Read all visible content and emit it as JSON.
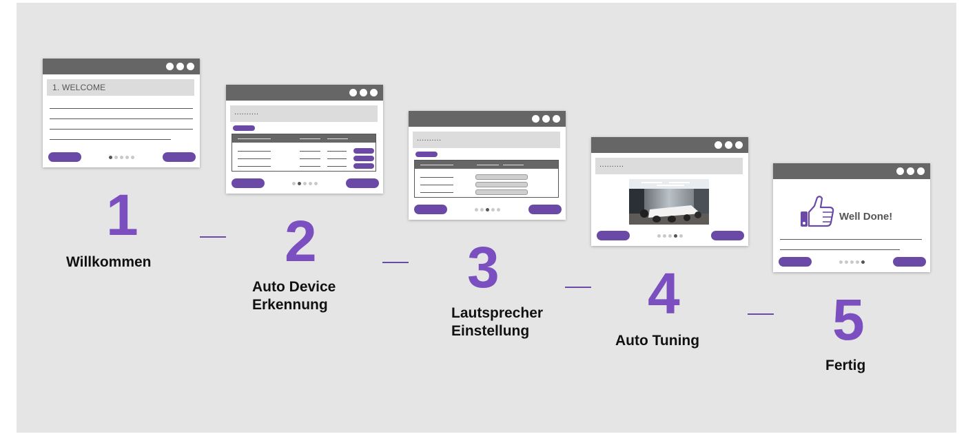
{
  "colors": {
    "accent": "#6a4aa6",
    "number": "#7b4fc0",
    "titlebar": "#666666",
    "header_bg": "#dcdcdc",
    "canvas": "#e5e5e5"
  },
  "steps": [
    {
      "number": "1",
      "label": "Willkommen",
      "screen_title": "1. WELCOME",
      "active_page": 1
    },
    {
      "number": "2",
      "label": "Auto Device Erkennung",
      "screen_title": "..........",
      "active_page": 2
    },
    {
      "number": "3",
      "label": "Lautsprecher Einstellung",
      "screen_title": "..........",
      "active_page": 3
    },
    {
      "number": "4",
      "label": "Auto Tuning",
      "screen_title": "..........",
      "active_page": 4
    },
    {
      "number": "5",
      "label": "Fertig",
      "screen_title": "Well Done!",
      "active_page": 5
    }
  ],
  "icons": {
    "window_controls": "three-dots-icon",
    "done": "thumbs-up-icon",
    "room": "conference-room-photo"
  }
}
